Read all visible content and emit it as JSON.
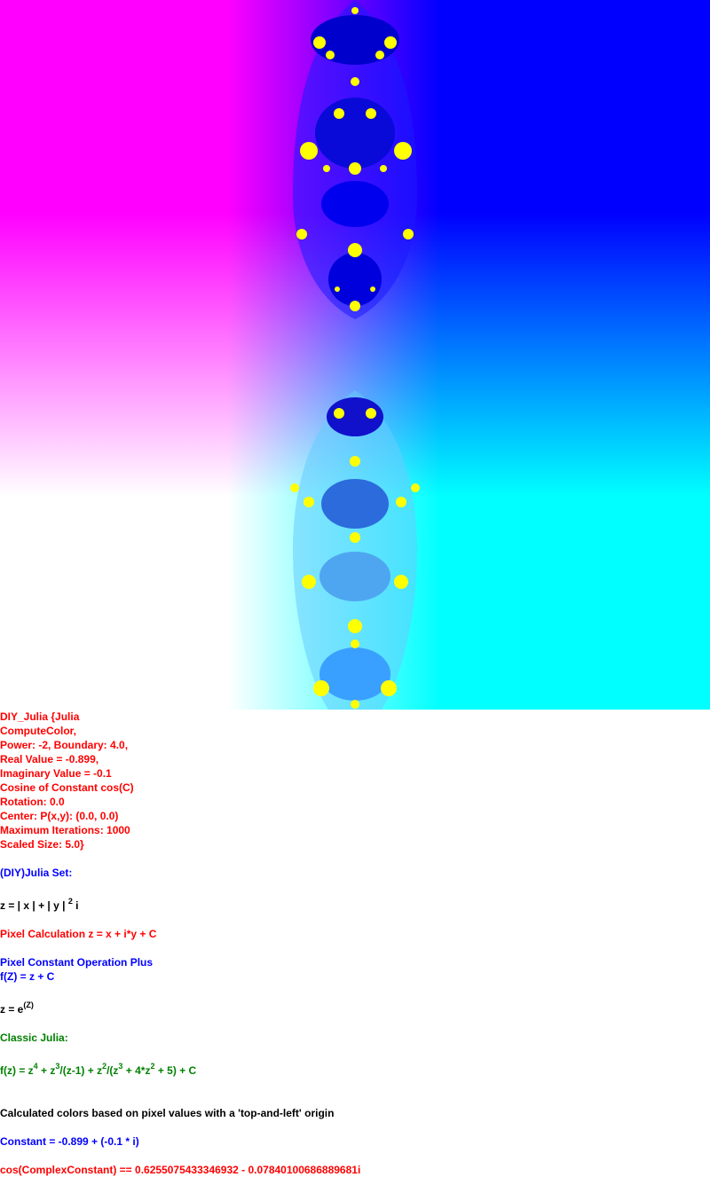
{
  "colors": {
    "magenta": "#ff00ff",
    "blue": "#0000ff",
    "cyan": "#00ffff",
    "white": "#ffffff",
    "yellow": "#ffff00",
    "dark_blue": "#0000cc",
    "mid_blue": "#2b6bdc"
  },
  "params": [
    "DIY_Julia {Julia",
    "ComputeColor,",
    "Power: -2, Boundary: 4.0,",
    "Real Value = -0.899,",
    "Imaginary Value = -0.1",
    "Cosine of Constant cos(C)",
    "Rotation: 0.0",
    "Center: P(x,y): (0.0, 0.0)",
    "Maximum Iterations: 1000",
    "Scaled Size: 5.0}"
  ],
  "set_heading": "(DIY)Julia Set:",
  "z_formula": {
    "base": "z = | x | + | y |",
    "exp": "2",
    "tail": " i"
  },
  "pixel_calc": "Pixel Calculation z = x + i*y + C",
  "const_op": "Pixel Constant Operation Plus",
  "fz": "f(Z) = z + C",
  "z_exp": {
    "base": "z = e",
    "exp": "(Z)"
  },
  "classic": "Classic Julia:",
  "classic_formula": {
    "p1": "f(z) = z",
    "e1": "4",
    "p2": " + z",
    "e2": "3",
    "p3": "/(z-1) + z",
    "e3": "2",
    "p4": "/(z",
    "e4": "3",
    "p5": " + 4*z",
    "e5": "2",
    "p6": " + 5) + C"
  },
  "origin_note": "Calculated colors based on pixel values with a 'top-and-left' origin",
  "constant": "Constant = -0.899 + (-0.1 * i)",
  "cos_constant": "cos(ComplexConstant) == 0.6255075433346932 - 0.07840100686889681i"
}
